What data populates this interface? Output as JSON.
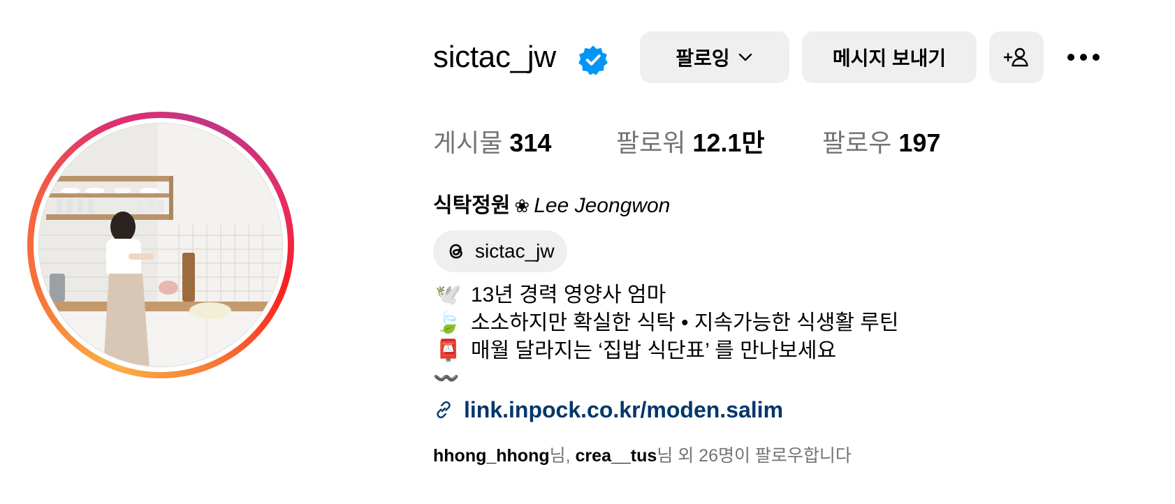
{
  "profile": {
    "username": "sictac_jw",
    "verified_icon": "verified-badge-icon",
    "colors": {
      "verified": "#0095f6",
      "link": "#00376b",
      "secondary_text": "#737373",
      "button_bg": "#efefef"
    }
  },
  "actions": {
    "follow_label": "팔로잉",
    "message_label": "메시지 보내기",
    "add_person_icon": "add-person-icon",
    "more_icon": "more-options-icon"
  },
  "stats": {
    "posts_label": "게시물",
    "posts_value": "314",
    "followers_label": "팔로워",
    "followers_value": "12.1만",
    "following_label": "팔로우",
    "following_value": "197"
  },
  "bio": {
    "name_ko": "식탁정원",
    "name_icon": "❀",
    "name_en": "Lee Jeongwon",
    "threads_handle": "sictac_jw",
    "lines": [
      {
        "emoji": "🕊️",
        "text": "13년 경력 영양사 엄마"
      },
      {
        "emoji": "🍃",
        "text": "소소하지만 확실한 식탁 • 지속가능한 식생활 루틴"
      },
      {
        "emoji": "📮",
        "text": "매월 달라지는 ‘집밥 식단표’ 를 만나보세요"
      }
    ],
    "wave": "〰️",
    "link": "link.inpock.co.kr/moden.salim"
  },
  "followed_by": {
    "user1": "hhong_hhong",
    "sep1": "님, ",
    "user2": "crea__tus",
    "suffix": "님 외 26명이 팔로우합니다"
  }
}
